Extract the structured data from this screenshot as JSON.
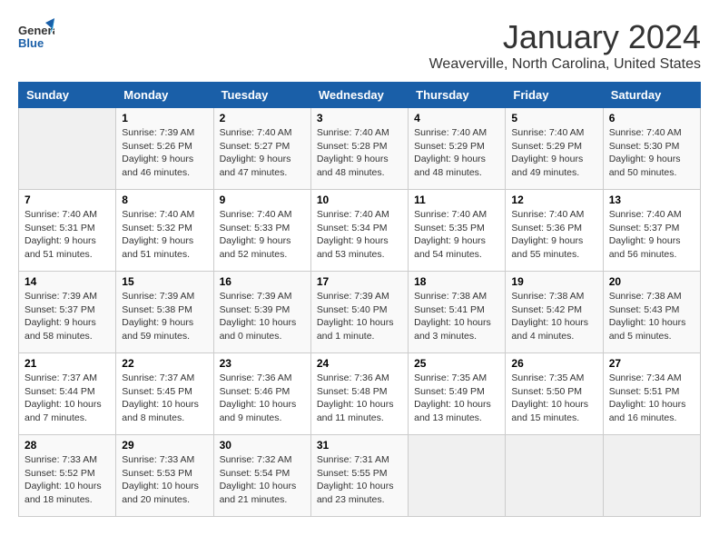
{
  "header": {
    "logo_general": "General",
    "logo_blue": "Blue",
    "month_year": "January 2024",
    "location": "Weaverville, North Carolina, United States"
  },
  "days_of_week": [
    "Sunday",
    "Monday",
    "Tuesday",
    "Wednesday",
    "Thursday",
    "Friday",
    "Saturday"
  ],
  "weeks": [
    [
      {
        "day": "",
        "sunrise": "",
        "sunset": "",
        "daylight": ""
      },
      {
        "day": "1",
        "sunrise": "Sunrise: 7:39 AM",
        "sunset": "Sunset: 5:26 PM",
        "daylight": "Daylight: 9 hours and 46 minutes."
      },
      {
        "day": "2",
        "sunrise": "Sunrise: 7:40 AM",
        "sunset": "Sunset: 5:27 PM",
        "daylight": "Daylight: 9 hours and 47 minutes."
      },
      {
        "day": "3",
        "sunrise": "Sunrise: 7:40 AM",
        "sunset": "Sunset: 5:28 PM",
        "daylight": "Daylight: 9 hours and 48 minutes."
      },
      {
        "day": "4",
        "sunrise": "Sunrise: 7:40 AM",
        "sunset": "Sunset: 5:29 PM",
        "daylight": "Daylight: 9 hours and 48 minutes."
      },
      {
        "day": "5",
        "sunrise": "Sunrise: 7:40 AM",
        "sunset": "Sunset: 5:29 PM",
        "daylight": "Daylight: 9 hours and 49 minutes."
      },
      {
        "day": "6",
        "sunrise": "Sunrise: 7:40 AM",
        "sunset": "Sunset: 5:30 PM",
        "daylight": "Daylight: 9 hours and 50 minutes."
      }
    ],
    [
      {
        "day": "7",
        "sunrise": "Sunrise: 7:40 AM",
        "sunset": "Sunset: 5:31 PM",
        "daylight": "Daylight: 9 hours and 51 minutes."
      },
      {
        "day": "8",
        "sunrise": "Sunrise: 7:40 AM",
        "sunset": "Sunset: 5:32 PM",
        "daylight": "Daylight: 9 hours and 51 minutes."
      },
      {
        "day": "9",
        "sunrise": "Sunrise: 7:40 AM",
        "sunset": "Sunset: 5:33 PM",
        "daylight": "Daylight: 9 hours and 52 minutes."
      },
      {
        "day": "10",
        "sunrise": "Sunrise: 7:40 AM",
        "sunset": "Sunset: 5:34 PM",
        "daylight": "Daylight: 9 hours and 53 minutes."
      },
      {
        "day": "11",
        "sunrise": "Sunrise: 7:40 AM",
        "sunset": "Sunset: 5:35 PM",
        "daylight": "Daylight: 9 hours and 54 minutes."
      },
      {
        "day": "12",
        "sunrise": "Sunrise: 7:40 AM",
        "sunset": "Sunset: 5:36 PM",
        "daylight": "Daylight: 9 hours and 55 minutes."
      },
      {
        "day": "13",
        "sunrise": "Sunrise: 7:40 AM",
        "sunset": "Sunset: 5:37 PM",
        "daylight": "Daylight: 9 hours and 56 minutes."
      }
    ],
    [
      {
        "day": "14",
        "sunrise": "Sunrise: 7:39 AM",
        "sunset": "Sunset: 5:37 PM",
        "daylight": "Daylight: 9 hours and 58 minutes."
      },
      {
        "day": "15",
        "sunrise": "Sunrise: 7:39 AM",
        "sunset": "Sunset: 5:38 PM",
        "daylight": "Daylight: 9 hours and 59 minutes."
      },
      {
        "day": "16",
        "sunrise": "Sunrise: 7:39 AM",
        "sunset": "Sunset: 5:39 PM",
        "daylight": "Daylight: 10 hours and 0 minutes."
      },
      {
        "day": "17",
        "sunrise": "Sunrise: 7:39 AM",
        "sunset": "Sunset: 5:40 PM",
        "daylight": "Daylight: 10 hours and 1 minute."
      },
      {
        "day": "18",
        "sunrise": "Sunrise: 7:38 AM",
        "sunset": "Sunset: 5:41 PM",
        "daylight": "Daylight: 10 hours and 3 minutes."
      },
      {
        "day": "19",
        "sunrise": "Sunrise: 7:38 AM",
        "sunset": "Sunset: 5:42 PM",
        "daylight": "Daylight: 10 hours and 4 minutes."
      },
      {
        "day": "20",
        "sunrise": "Sunrise: 7:38 AM",
        "sunset": "Sunset: 5:43 PM",
        "daylight": "Daylight: 10 hours and 5 minutes."
      }
    ],
    [
      {
        "day": "21",
        "sunrise": "Sunrise: 7:37 AM",
        "sunset": "Sunset: 5:44 PM",
        "daylight": "Daylight: 10 hours and 7 minutes."
      },
      {
        "day": "22",
        "sunrise": "Sunrise: 7:37 AM",
        "sunset": "Sunset: 5:45 PM",
        "daylight": "Daylight: 10 hours and 8 minutes."
      },
      {
        "day": "23",
        "sunrise": "Sunrise: 7:36 AM",
        "sunset": "Sunset: 5:46 PM",
        "daylight": "Daylight: 10 hours and 9 minutes."
      },
      {
        "day": "24",
        "sunrise": "Sunrise: 7:36 AM",
        "sunset": "Sunset: 5:48 PM",
        "daylight": "Daylight: 10 hours and 11 minutes."
      },
      {
        "day": "25",
        "sunrise": "Sunrise: 7:35 AM",
        "sunset": "Sunset: 5:49 PM",
        "daylight": "Daylight: 10 hours and 13 minutes."
      },
      {
        "day": "26",
        "sunrise": "Sunrise: 7:35 AM",
        "sunset": "Sunset: 5:50 PM",
        "daylight": "Daylight: 10 hours and 15 minutes."
      },
      {
        "day": "27",
        "sunrise": "Sunrise: 7:34 AM",
        "sunset": "Sunset: 5:51 PM",
        "daylight": "Daylight: 10 hours and 16 minutes."
      }
    ],
    [
      {
        "day": "28",
        "sunrise": "Sunrise: 7:33 AM",
        "sunset": "Sunset: 5:52 PM",
        "daylight": "Daylight: 10 hours and 18 minutes."
      },
      {
        "day": "29",
        "sunrise": "Sunrise: 7:33 AM",
        "sunset": "Sunset: 5:53 PM",
        "daylight": "Daylight: 10 hours and 20 minutes."
      },
      {
        "day": "30",
        "sunrise": "Sunrise: 7:32 AM",
        "sunset": "Sunset: 5:54 PM",
        "daylight": "Daylight: 10 hours and 21 minutes."
      },
      {
        "day": "31",
        "sunrise": "Sunrise: 7:31 AM",
        "sunset": "Sunset: 5:55 PM",
        "daylight": "Daylight: 10 hours and 23 minutes."
      },
      {
        "day": "",
        "sunrise": "",
        "sunset": "",
        "daylight": ""
      },
      {
        "day": "",
        "sunrise": "",
        "sunset": "",
        "daylight": ""
      },
      {
        "day": "",
        "sunrise": "",
        "sunset": "",
        "daylight": ""
      }
    ]
  ]
}
